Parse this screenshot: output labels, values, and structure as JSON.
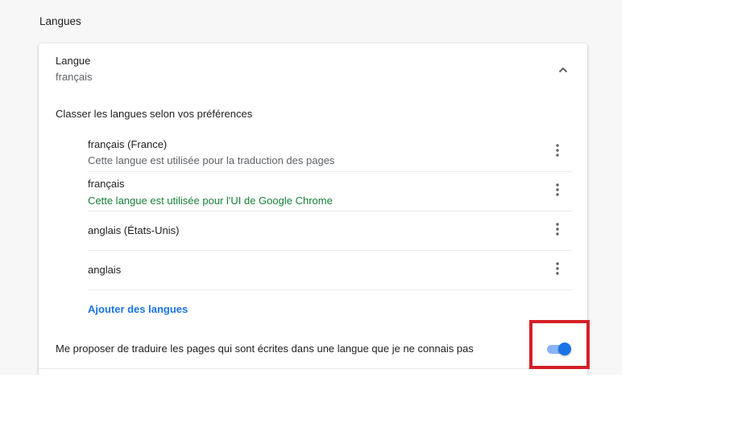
{
  "section": {
    "title": "Langues"
  },
  "language": {
    "title": "Langue",
    "current": "français"
  },
  "order": {
    "label": "Classer les langues selon vos préférences",
    "items": [
      {
        "name": "français (France)",
        "note": "Cette langue est utilisée pour la traduction des pages"
      },
      {
        "name": "français",
        "note": "Cette langue est utilisée pour l'UI de Google Chrome"
      },
      {
        "name": "anglais (États-Unis)"
      },
      {
        "name": "anglais"
      }
    ]
  },
  "add_languages": {
    "label": "Ajouter des langues"
  },
  "translate": {
    "label": "Me proposer de traduire les pages qui sont écrites dans une langue que je ne connais pas",
    "enabled": true
  },
  "icons": {
    "collapse": "chevron-up-icon",
    "menu": "more-vert-icon"
  },
  "colors": {
    "accent": "#1a73e8",
    "toggle_track": "#8ab4f8",
    "ui_language_note": "#188038",
    "highlight": "#d42027"
  }
}
